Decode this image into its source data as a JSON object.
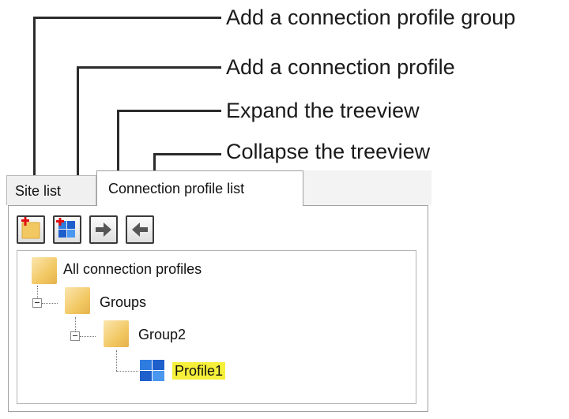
{
  "callouts": {
    "add_group": "Add a connection profile group",
    "add_profile": "Add a connection profile",
    "expand": "Expand the treeview",
    "collapse": "Collapse the treeview"
  },
  "tabs": {
    "site_list": "Site list",
    "connection_profile_list": "Connection profile list",
    "active": "Connection profile list"
  },
  "toolbar": {
    "add_group_icon": "folder-add-icon",
    "add_profile_icon": "profile-add-icon",
    "expand_icon": "arrow-right-icon",
    "collapse_icon": "arrow-left-icon"
  },
  "tree": {
    "root": "All connection profiles",
    "groups": "Groups",
    "group2": "Group2",
    "profile1": "Profile1",
    "selected": "Profile1"
  },
  "colors": {
    "selection_highlight": "#f6f03a",
    "folder": "#f2c863",
    "profile_blue": "#1f5fcc",
    "add_red": "#e01010"
  }
}
